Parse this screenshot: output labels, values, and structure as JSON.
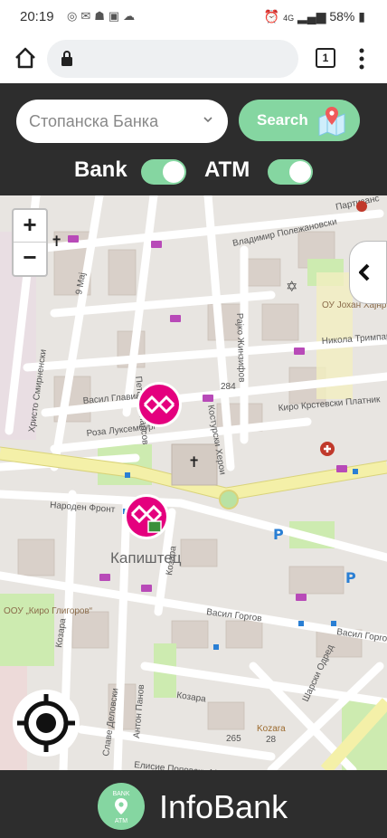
{
  "status_bar": {
    "time": "20:19",
    "battery": "58%",
    "network": "4G"
  },
  "browser": {
    "tab_count": "1"
  },
  "header": {
    "bank_select": {
      "selected": "Стопанска Банка"
    },
    "search_button_label": "Search",
    "toggles": [
      {
        "label": "Bank",
        "on": true
      },
      {
        "label": "ATM",
        "on": true
      }
    ]
  },
  "map": {
    "zoom_in": "+",
    "zoom_out": "−",
    "labels": {
      "street_polezhanovski": "Владимир Полежановски",
      "street_kartazhanov": "Партизанс",
      "street_majka": "9 Мај",
      "street_petar_poparsov": "Петар Попарсов",
      "street_raiko": "Рајко Жинзифов",
      "street_hristo": "Христо Смирненски",
      "street_vasil": "Васил Главинов",
      "street_roza": "Роза Луксембург",
      "street_kosturski": "Костурски Херои",
      "street_kiro": "Киро Крстевски Платник",
      "street_narodeni": "Народен Фронт",
      "street_vasil_gorgov": "Васил Горгов",
      "street_vasil_gorgov2": "Васил Горгов",
      "street_kozara": "Козара",
      "street_kozara2": "Козара",
      "street_kozara3": "Козара",
      "street_sharski": "Шарски Одред",
      "street_slave": "Славе Деловски",
      "street_anton": "Антон Панов",
      "street_elisie": "Елисие Поповски Марко",
      "district": "Капиштец",
      "school1": "ОУ Јохан Хајнрих Песталоци",
      "school2": "ООУ „Киро Глигоров“",
      "street_nikola": "Никола Тримпаре",
      "house_284": "284",
      "house_265": "265",
      "house_28": "28",
      "kozara_num": "Kozara"
    }
  },
  "footer": {
    "logo_top": "BANK",
    "logo_bottom": "ATM",
    "title": "InfoBank"
  },
  "colors": {
    "accent": "#85d6a1",
    "header_bg": "#2d2d2d",
    "marker": "#e4007e"
  }
}
